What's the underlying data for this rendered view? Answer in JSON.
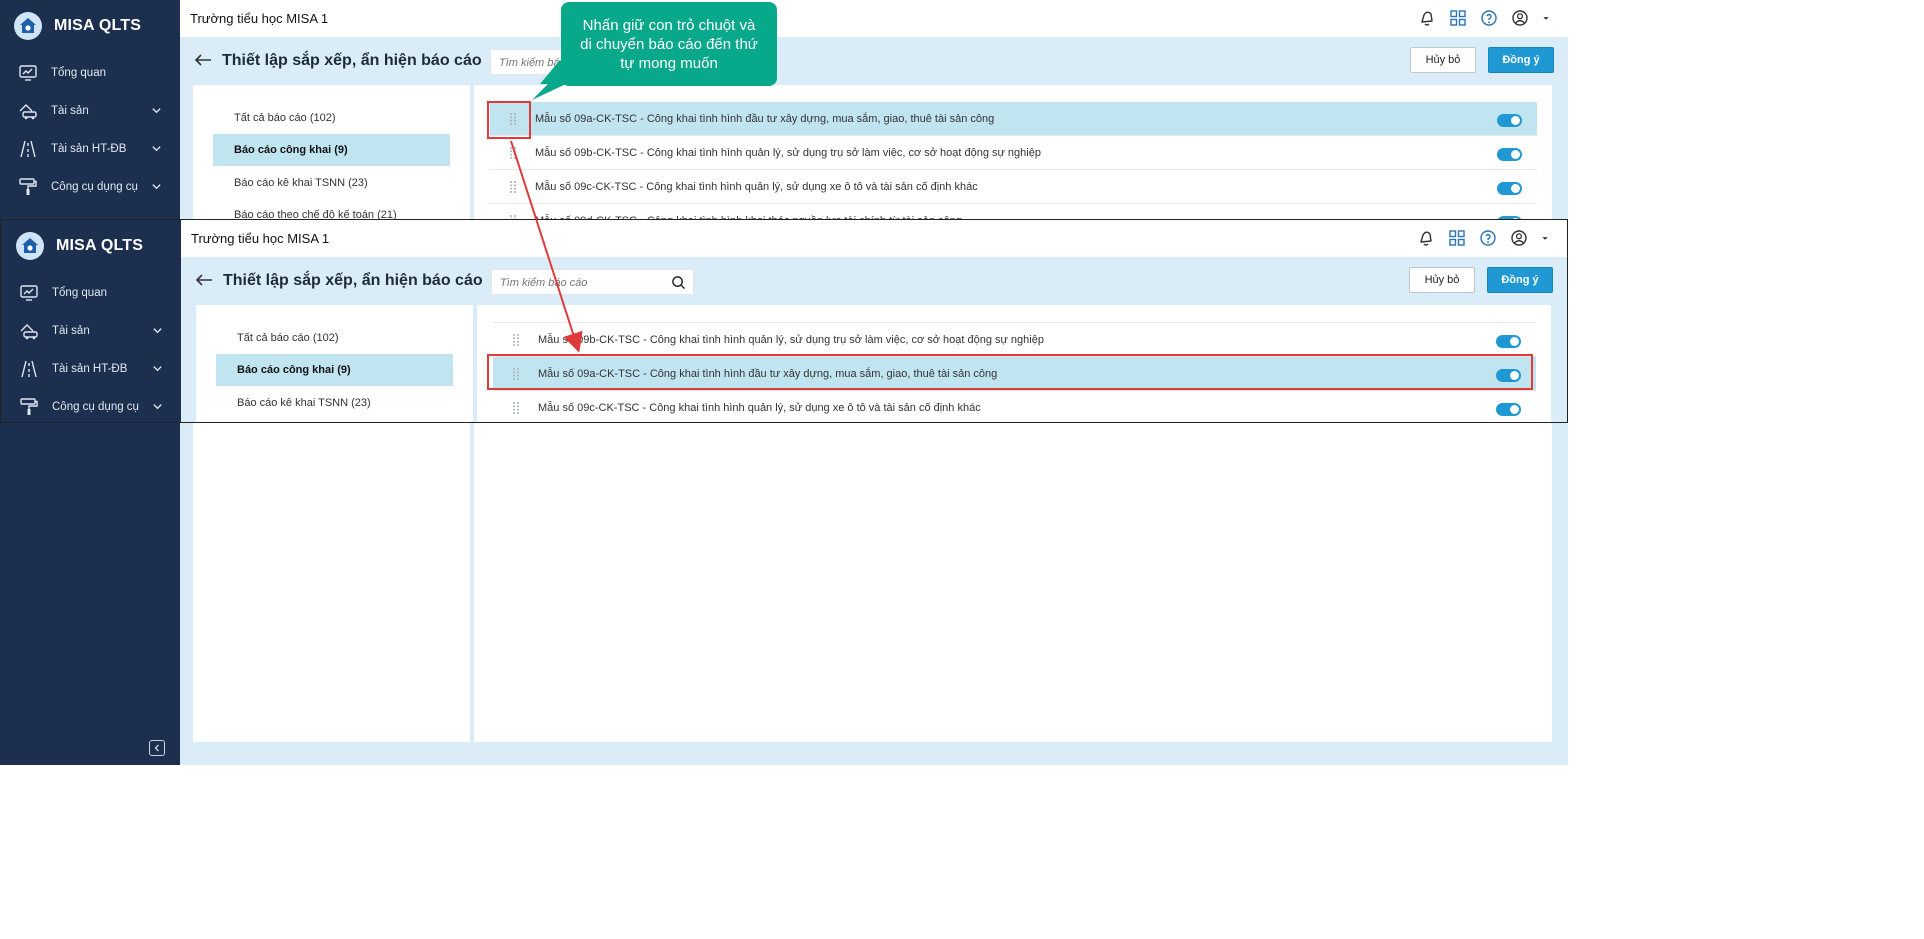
{
  "app": {
    "name": "MISA QLTS",
    "school": "Trường tiểu học MISA 1"
  },
  "sidebar": {
    "items": [
      {
        "label": "Tổng quan",
        "icon": "monitor-chart-icon"
      },
      {
        "label": "Tài sản",
        "icon": "car-house-icon"
      },
      {
        "label": "Tài sản HT-ĐB",
        "icon": "road-icon"
      },
      {
        "label": "Công cụ dụng cụ",
        "icon": "paint-roller-icon"
      }
    ]
  },
  "header": {
    "title": "Thiết lập sắp xếp, ẩn hiện báo cáo",
    "search_placeholder": "Tìm kiếm báo cáo",
    "cancel_label": "Hủy bỏ",
    "ok_label": "Đồng ý"
  },
  "categories": [
    {
      "label": "Tất cả báo cáo (102)",
      "active": false
    },
    {
      "label": "Báo cáo công khai (9)",
      "active": true
    },
    {
      "label": "Báo cáo kê khai TSNN (23)",
      "active": false
    },
    {
      "label": "Báo cáo theo chế độ kế toán (21)",
      "active": false
    }
  ],
  "reports_before": [
    {
      "label": "Mẫu số 09a-CK-TSC - Công khai tình hình đầu tư xây dựng, mua sắm, giao, thuê tài sản công",
      "enabled": true
    },
    {
      "label": "Mẫu số 09b-CK-TSC - Công khai tình hình quản lý, sử dụng trụ sở làm việc, cơ sở hoạt động sự nghiệp",
      "enabled": true
    },
    {
      "label": "Mẫu số 09c-CK-TSC - Công khai tình hình quản lý, sử dụng xe ô tô và tài sản cố định khác",
      "enabled": true
    },
    {
      "label": "Mẫu số 09d-CK-TSC - Công khai tình hình khai thác nguồn lực tài chính từ tài sản công",
      "enabled": true
    }
  ],
  "reports_after": [
    {
      "label": "Mẫu số 09b-CK-TSC - Công khai tình hình quản lý, sử dụng trụ sở làm việc, cơ sở hoạt động sự nghiệp",
      "enabled": true
    },
    {
      "label": "Mẫu số 09a-CK-TSC - Công khai tình hình đầu tư xây dựng, mua sắm, giao, thuê tài sản công",
      "enabled": true
    },
    {
      "label": "Mẫu số 09c-CK-TSC - Công khai tình hình quản lý, sử dụng xe ô tô và tài sản cố định khác",
      "enabled": true
    }
  ],
  "callout": {
    "text": "Nhấn giữ con trỏ chuột và di chuyển báo cáo đến thứ tự mong muốn"
  },
  "colors": {
    "sidebar": "#1d2f4e",
    "accent": "#1f98d4",
    "highlight": "#c1e4f1",
    "callout": "#08a98a",
    "annotation": "#e03a3a"
  }
}
